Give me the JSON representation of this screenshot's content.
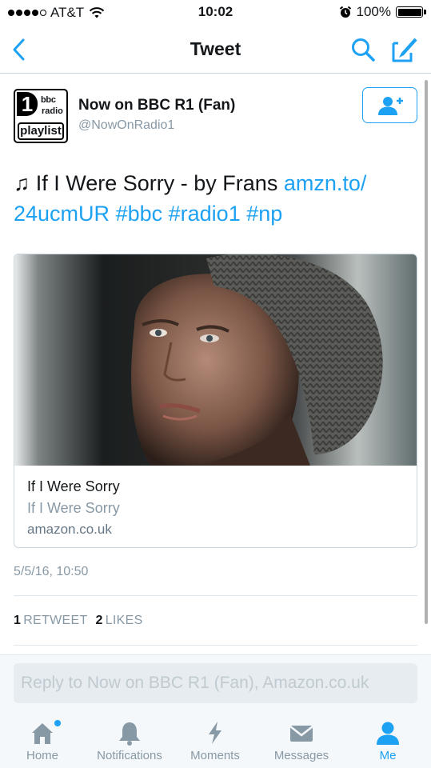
{
  "status_bar": {
    "carrier": "AT&T",
    "time": "10:02",
    "battery": "100%",
    "battery_level": 1.0
  },
  "nav": {
    "title": "Tweet",
    "back_icon": "chevron-left-icon",
    "search_icon": "search-icon",
    "compose_icon": "compose-icon"
  },
  "tweet": {
    "avatar_text": {
      "number": "1",
      "line1": "bbc",
      "line2": "radio",
      "line3": "playlist"
    },
    "name": "Now on BBC R1 (Fan)",
    "handle": "@NowOnRadio1",
    "follow_icon": "add-user-icon",
    "text_prefix": "♫ If I Were Sorry - by Frans ",
    "link": "amzn.to/24ucmUR",
    "link_part1": "amzn.to/",
    "link_part2": "24ucmUR",
    "hashtags": [
      "#bbc",
      "#radio1",
      "#np"
    ],
    "card": {
      "title": "If I Were Sorry",
      "description": "If I Were Sorry",
      "domain": "amazon.co.uk"
    },
    "timestamp": "5/5/16, 10:50",
    "retweets_count": "1",
    "retweets_label": "RETWEET",
    "likes_count": "2",
    "likes_label": "LIKES"
  },
  "reply": {
    "placeholder": "Reply to Now on BBC R1 (Fan), Amazon.co.uk"
  },
  "tabs": [
    {
      "label": "Home",
      "icon": "home-icon",
      "active": false
    },
    {
      "label": "Notifications",
      "icon": "bell-icon",
      "active": false
    },
    {
      "label": "Moments",
      "icon": "lightning-icon",
      "active": false
    },
    {
      "label": "Messages",
      "icon": "envelope-icon",
      "active": false
    },
    {
      "label": "Me",
      "icon": "person-icon",
      "active": true
    }
  ],
  "colors": {
    "accent": "#1da1f2",
    "secondary_text": "#8899a6",
    "tab_bar_bg": "#f5f8fa"
  }
}
